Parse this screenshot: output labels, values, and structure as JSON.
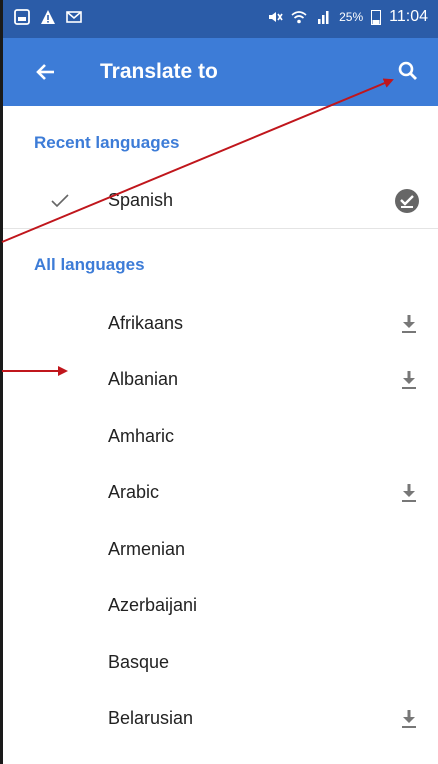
{
  "status_bar": {
    "battery": "25%",
    "time": "11:04"
  },
  "toolbar": {
    "title": "Translate to",
    "back_icon": "arrow-back-icon",
    "search_icon": "search-icon"
  },
  "recent": {
    "header": "Recent languages",
    "items": [
      {
        "label": "Spanish",
        "selected": true
      }
    ]
  },
  "all": {
    "header": "All languages",
    "items": [
      {
        "label": "Afrikaans",
        "downloadable": true
      },
      {
        "label": "Albanian",
        "downloadable": true
      },
      {
        "label": "Amharic",
        "downloadable": false
      },
      {
        "label": "Arabic",
        "downloadable": true
      },
      {
        "label": "Armenian",
        "downloadable": false
      },
      {
        "label": "Azerbaijani",
        "downloadable": false
      },
      {
        "label": "Basque",
        "downloadable": false
      },
      {
        "label": "Belarusian",
        "downloadable": true
      }
    ]
  },
  "colors": {
    "status_bar": "#2b5ca8",
    "toolbar": "#3d7cd7",
    "accent": "#3d7cd7",
    "annotation_arrow": "#c0161c"
  }
}
